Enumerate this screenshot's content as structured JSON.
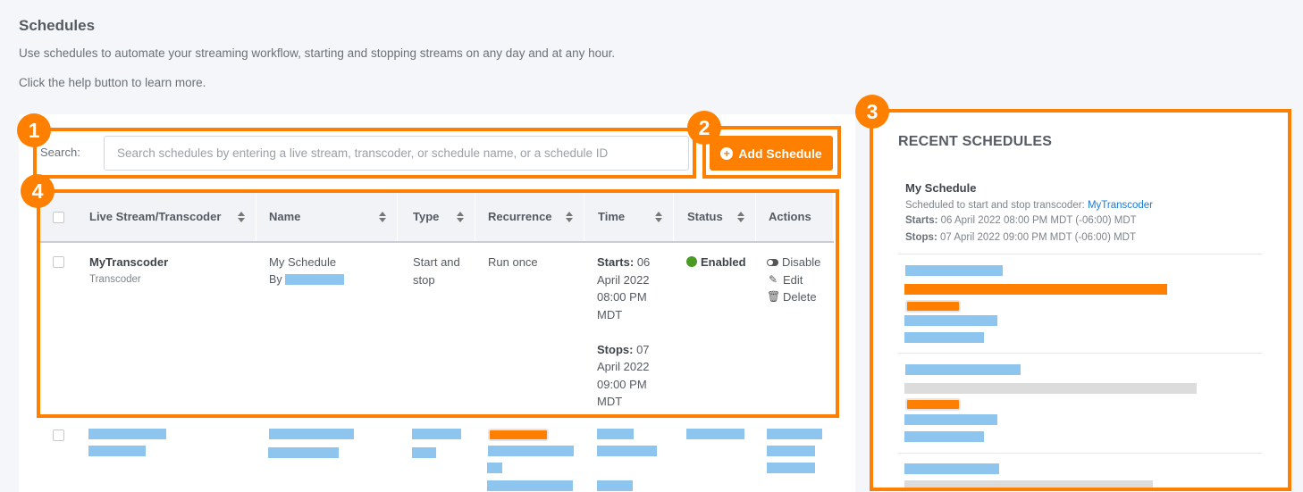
{
  "page": {
    "title": "Schedules",
    "intro_line1": "Use schedules to automate your streaming workflow, starting and stopping streams on any day and at any hour.",
    "intro_line2": "Click the help button to learn more."
  },
  "search": {
    "label": "Search:",
    "placeholder": "Search schedules by entering a live stream, transcoder, or schedule name, or a schedule ID",
    "value": ""
  },
  "add_button": {
    "label": "Add Schedule"
  },
  "table": {
    "columns": [
      "Live Stream/Transcoder",
      "Name",
      "Type",
      "Recurrence",
      "Time",
      "Status",
      "Actions"
    ],
    "row": {
      "stream": "MyTranscoder",
      "stream_sub": "Transcoder",
      "name": "My Schedule",
      "by_prefix": "By",
      "type_line1": "Start and",
      "type_line2": "stop",
      "recurrence": "Run once",
      "starts_label": "Starts:",
      "starts_value": "06",
      "starts_rest": [
        "April 2022",
        "08:00 PM",
        "MDT"
      ],
      "stops_label": "Stops:",
      "stops_value": "07",
      "stops_rest": [
        "April 2022",
        "09:00 PM",
        "MDT"
      ],
      "status": "Enabled",
      "actions": [
        "Disable",
        "Edit",
        "Delete"
      ]
    }
  },
  "recent": {
    "title": "RECENT SCHEDULES",
    "item_name": "My Schedule",
    "item_desc": "Scheduled to start and stop transcoder:",
    "item_link": "MyTranscoder",
    "starts_label": "Starts:",
    "starts_value": "06 April 2022 08:00 PM MDT (-06:00) MDT",
    "stops_label": "Stops:",
    "stops_value": "07 April 2022 09:00 PM MDT (-06:00) MDT"
  },
  "callouts": [
    "1",
    "2",
    "3",
    "4"
  ],
  "colors": {
    "accent": "#ff7f00",
    "enabled": "#4a9a25",
    "link": "#1b7ad2",
    "redacted": "#8ec5ee"
  }
}
